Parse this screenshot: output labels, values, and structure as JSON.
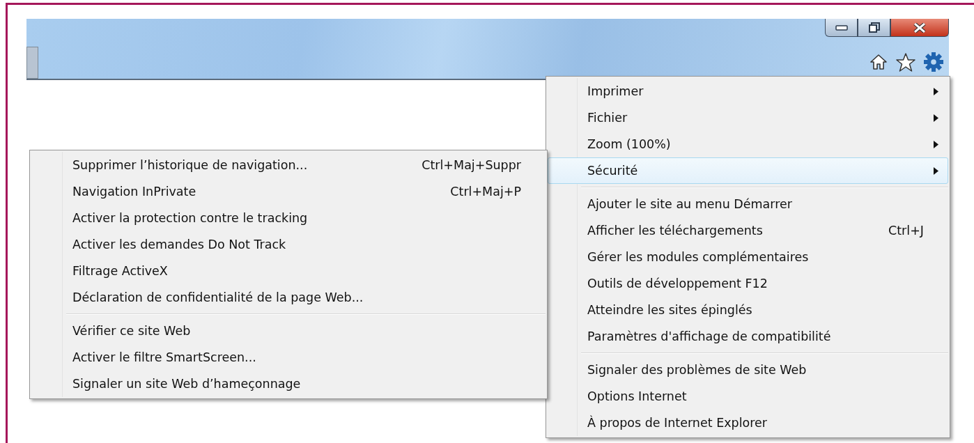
{
  "window_controls": [
    {
      "kind": "minimize"
    },
    {
      "kind": "restore"
    },
    {
      "kind": "close"
    }
  ],
  "toolbar_icons": [
    {
      "kind": "home"
    },
    {
      "kind": "favorites"
    },
    {
      "kind": "tools"
    }
  ],
  "tools_menu": {
    "groups": [
      [
        {
          "label": "Imprimer",
          "submenu": true,
          "selected": false
        },
        {
          "label": "Fichier",
          "submenu": true,
          "selected": false
        },
        {
          "label": "Zoom (100%)",
          "submenu": true,
          "selected": false
        },
        {
          "label": "Sécurité",
          "submenu": true,
          "selected": true
        }
      ],
      [
        {
          "label": "Ajouter le site au menu Démarrer",
          "submenu": false,
          "selected": false
        },
        {
          "label": "Afficher les téléchargements",
          "shortcut": "Ctrl+J",
          "submenu": false,
          "selected": false
        },
        {
          "label": "Gérer les modules complémentaires",
          "submenu": false,
          "selected": false
        },
        {
          "label": "Outils de développement F12",
          "submenu": false,
          "selected": false
        },
        {
          "label": "Atteindre les sites épinglés",
          "submenu": false,
          "selected": false
        },
        {
          "label": "Paramètres d'affichage de compatibilité",
          "submenu": false,
          "selected": false
        }
      ],
      [
        {
          "label": "Signaler des problèmes de site Web",
          "submenu": false,
          "selected": false
        },
        {
          "label": "Options Internet",
          "submenu": false,
          "selected": false
        },
        {
          "label": "À propos de Internet Explorer",
          "submenu": false,
          "selected": false
        }
      ]
    ]
  },
  "security_submenu": {
    "groups": [
      [
        {
          "label": "Supprimer l’historique de navigation...",
          "shortcut": "Ctrl+Maj+Suppr"
        },
        {
          "label": "Navigation InPrivate",
          "shortcut": "Ctrl+Maj+P"
        },
        {
          "label": "Activer la protection contre le tracking"
        },
        {
          "label": "Activer les demandes Do Not Track"
        },
        {
          "label": "Filtrage ActiveX"
        },
        {
          "label": "Déclaration de confidentialité de la page Web..."
        }
      ],
      [
        {
          "label": "Vérifier ce site Web"
        },
        {
          "label": "Activer le filtre SmartScreen..."
        },
        {
          "label": "Signaler un site Web d’hameçonnage"
        }
      ]
    ]
  }
}
